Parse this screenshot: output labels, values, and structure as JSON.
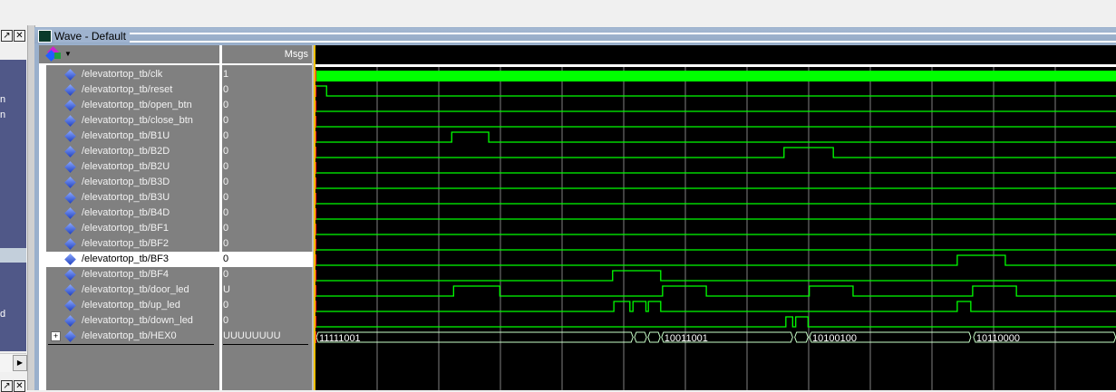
{
  "left_panel": {
    "fragments": [
      "n",
      "n",
      "d"
    ]
  },
  "window": {
    "title": "Wave - Default",
    "msgs_header": "Msgs"
  },
  "grid": {
    "units_per_division": 100,
    "total_units": 1298
  },
  "signals": [
    {
      "name": "/elevatortop_tb/clk",
      "value": "1",
      "type": "clock"
    },
    {
      "name": "/elevatortop_tb/reset",
      "value": "0",
      "type": "bit",
      "init": 1,
      "edges": [
        18
      ]
    },
    {
      "name": "/elevatortop_tb/open_btn",
      "value": "0",
      "type": "bit",
      "init": 0,
      "edges": []
    },
    {
      "name": "/elevatortop_tb/close_btn",
      "value": "0",
      "type": "bit",
      "init": 0,
      "edges": []
    },
    {
      "name": "/elevatortop_tb/B1U",
      "value": "0",
      "type": "bit",
      "init": 0,
      "edges": [
        221,
        281
      ]
    },
    {
      "name": "/elevatortop_tb/B2D",
      "value": "0",
      "type": "bit",
      "init": 0,
      "edges": [
        760,
        840
      ]
    },
    {
      "name": "/elevatortop_tb/B2U",
      "value": "0",
      "type": "bit",
      "init": 0,
      "edges": []
    },
    {
      "name": "/elevatortop_tb/B3D",
      "value": "0",
      "type": "bit",
      "init": 0,
      "edges": []
    },
    {
      "name": "/elevatortop_tb/B3U",
      "value": "0",
      "type": "bit",
      "init": 0,
      "edges": []
    },
    {
      "name": "/elevatortop_tb/B4D",
      "value": "0",
      "type": "bit",
      "init": 0,
      "edges": []
    },
    {
      "name": "/elevatortop_tb/BF1",
      "value": "0",
      "type": "bit",
      "init": 0,
      "edges": []
    },
    {
      "name": "/elevatortop_tb/BF2",
      "value": "0",
      "type": "bit",
      "init": 0,
      "edges": []
    },
    {
      "name": "/elevatortop_tb/BF3",
      "value": "0",
      "type": "bit",
      "init": 0,
      "edges": [
        1041,
        1119
      ],
      "selected": true
    },
    {
      "name": "/elevatortop_tb/BF4",
      "value": "0",
      "type": "bit",
      "init": 0,
      "edges": [
        482,
        560
      ]
    },
    {
      "name": "/elevatortop_tb/door_led",
      "value": "U",
      "type": "bit",
      "init": 0,
      "edges": [
        224,
        299,
        563,
        634,
        801,
        872,
        1066,
        1137
      ]
    },
    {
      "name": "/elevatortop_tb/up_led",
      "value": "0",
      "type": "bit",
      "init": 0,
      "edges": [
        484,
        510,
        515,
        536,
        540,
        560,
        1041,
        1063
      ]
    },
    {
      "name": "/elevatortop_tb/down_led",
      "value": "0",
      "type": "bit",
      "init": 0,
      "edges": [
        763,
        774,
        779,
        799
      ]
    },
    {
      "name": "/elevatortop_tb/HEX0",
      "value": "UUUUUUUU",
      "type": "bus",
      "expandable": true,
      "segments": [
        {
          "start": 0,
          "end": 515,
          "label": "11111001"
        },
        {
          "start": 516,
          "end": 537,
          "label": ""
        },
        {
          "start": 538,
          "end": 559,
          "label": ""
        },
        {
          "start": 560,
          "end": 774,
          "label": "10011001"
        },
        {
          "start": 776,
          "end": 799,
          "label": ""
        },
        {
          "start": 800,
          "end": 1063,
          "label": "10100100"
        },
        {
          "start": 1066,
          "end": 1298,
          "label": "10110000"
        }
      ]
    }
  ],
  "colors": {
    "wave": "#00ff00",
    "bus": "#c8ffc8",
    "grid": "#808080",
    "cursor": "#f0c000"
  }
}
